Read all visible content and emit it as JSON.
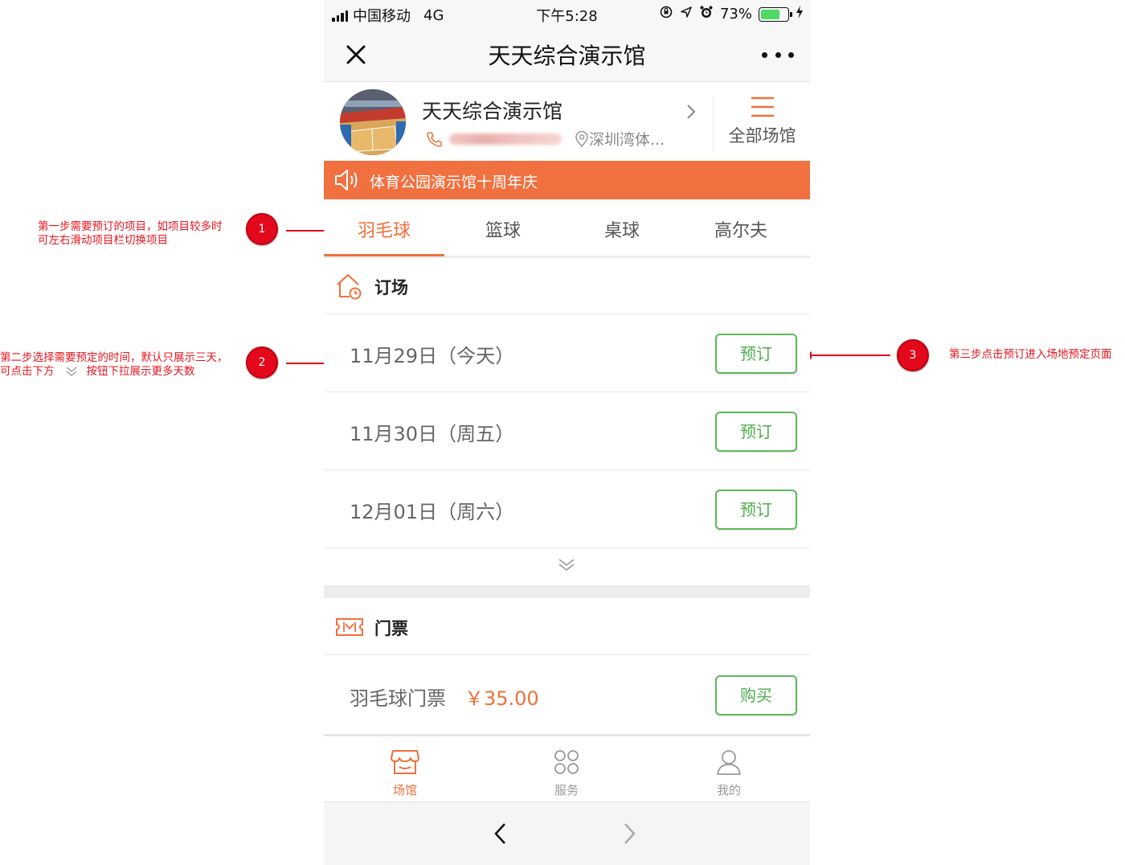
{
  "status_bar": {
    "carrier": "中国移动",
    "network": "4G",
    "time": "下午5:28",
    "battery": "73%",
    "battery_level": 0.73
  },
  "nav": {
    "title": "天天综合演示馆"
  },
  "venue": {
    "name": "天天综合演示馆",
    "location": "深圳湾体...",
    "all_venues_label": "全部场馆"
  },
  "notice": {
    "text": "体育公园演示馆十周年庆"
  },
  "tabs": [
    "羽毛球",
    "篮球",
    "桌球",
    "高尔夫"
  ],
  "booking": {
    "title": "订场",
    "rows": [
      {
        "date": "11月29日（今天）",
        "button": "预订"
      },
      {
        "date": "11月30日（周五）",
        "button": "预订"
      },
      {
        "date": "12月01日（周六）",
        "button": "预订"
      }
    ]
  },
  "tickets": {
    "title": "门票",
    "items": [
      {
        "name": "羽毛球门票",
        "price": "￥35.00",
        "button": "购买"
      }
    ]
  },
  "tab_bar": {
    "items": [
      {
        "label": "场馆",
        "icon": "venue-icon"
      },
      {
        "label": "服务",
        "icon": "service-icon"
      },
      {
        "label": "我的",
        "icon": "profile-icon"
      }
    ]
  },
  "annotations": {
    "step1_line1": "第一步需要预订的项目，如项目较多时",
    "step1_line2": "可左右滑动项目栏切换项目",
    "step1_badge": "1",
    "step2_line1": "第二步选择需要预定的时间，默认只展示三天，",
    "step2_line2a": "可点击下方",
    "step2_line2b": "按钮下拉展示更多天数",
    "step2_badge": "2",
    "step3_text": "第三步点击预订进入场地预定页面",
    "step3_badge": "3"
  },
  "colors": {
    "accent": "#f0703a",
    "notice_bg": "#f1703f",
    "button_green": "#5cb85c",
    "annotation_red": "#e3081b"
  }
}
